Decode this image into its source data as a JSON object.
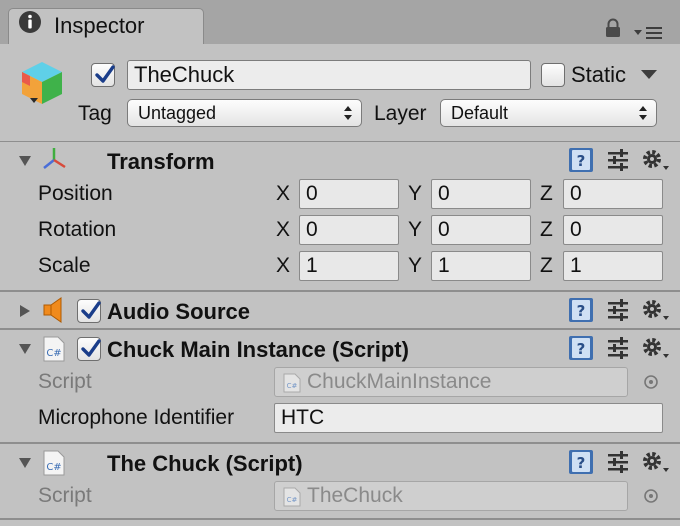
{
  "window": {
    "tab_title": "Inspector"
  },
  "gameobject": {
    "active": true,
    "name": "TheChuck",
    "static_label": "Static",
    "static": false,
    "tag_label": "Tag",
    "tag_value": "Untagged",
    "layer_label": "Layer",
    "layer_value": "Default"
  },
  "transform": {
    "title": "Transform",
    "rows": [
      {
        "label": "Position",
        "x": "0",
        "y": "0",
        "z": "0"
      },
      {
        "label": "Rotation",
        "x": "0",
        "y": "0",
        "z": "0"
      },
      {
        "label": "Scale",
        "x": "1",
        "y": "1",
        "z": "1"
      }
    ],
    "axes": {
      "x": "X",
      "y": "Y",
      "z": "Z"
    }
  },
  "audio_source": {
    "title": "Audio Source",
    "enabled": true
  },
  "chuck_main": {
    "title": "Chuck Main Instance (Script)",
    "enabled": true,
    "script_label": "Script",
    "script_value": "ChuckMainInstance",
    "mic_label": "Microphone Identifier",
    "mic_value": "HTC"
  },
  "the_chuck": {
    "title": "The Chuck (Script)",
    "script_label": "Script",
    "script_value": "TheChuck"
  },
  "icons": {
    "tab": "info-icon",
    "lock": "lock-icon",
    "menu": "tab-menu-icon",
    "gameobject": "cube-icon",
    "transform": "transform-axes-icon",
    "audio": "speaker-icon",
    "script": "csharp-script-icon",
    "help": "help-book-icon",
    "presets": "presets-sliders-icon",
    "settings": "gear-icon"
  },
  "colors": {
    "background": "#c2c2c2",
    "tabbar": "#a5a5a5",
    "checkmark": "#1a3d8a",
    "accent_orange": "#f08a1c"
  }
}
